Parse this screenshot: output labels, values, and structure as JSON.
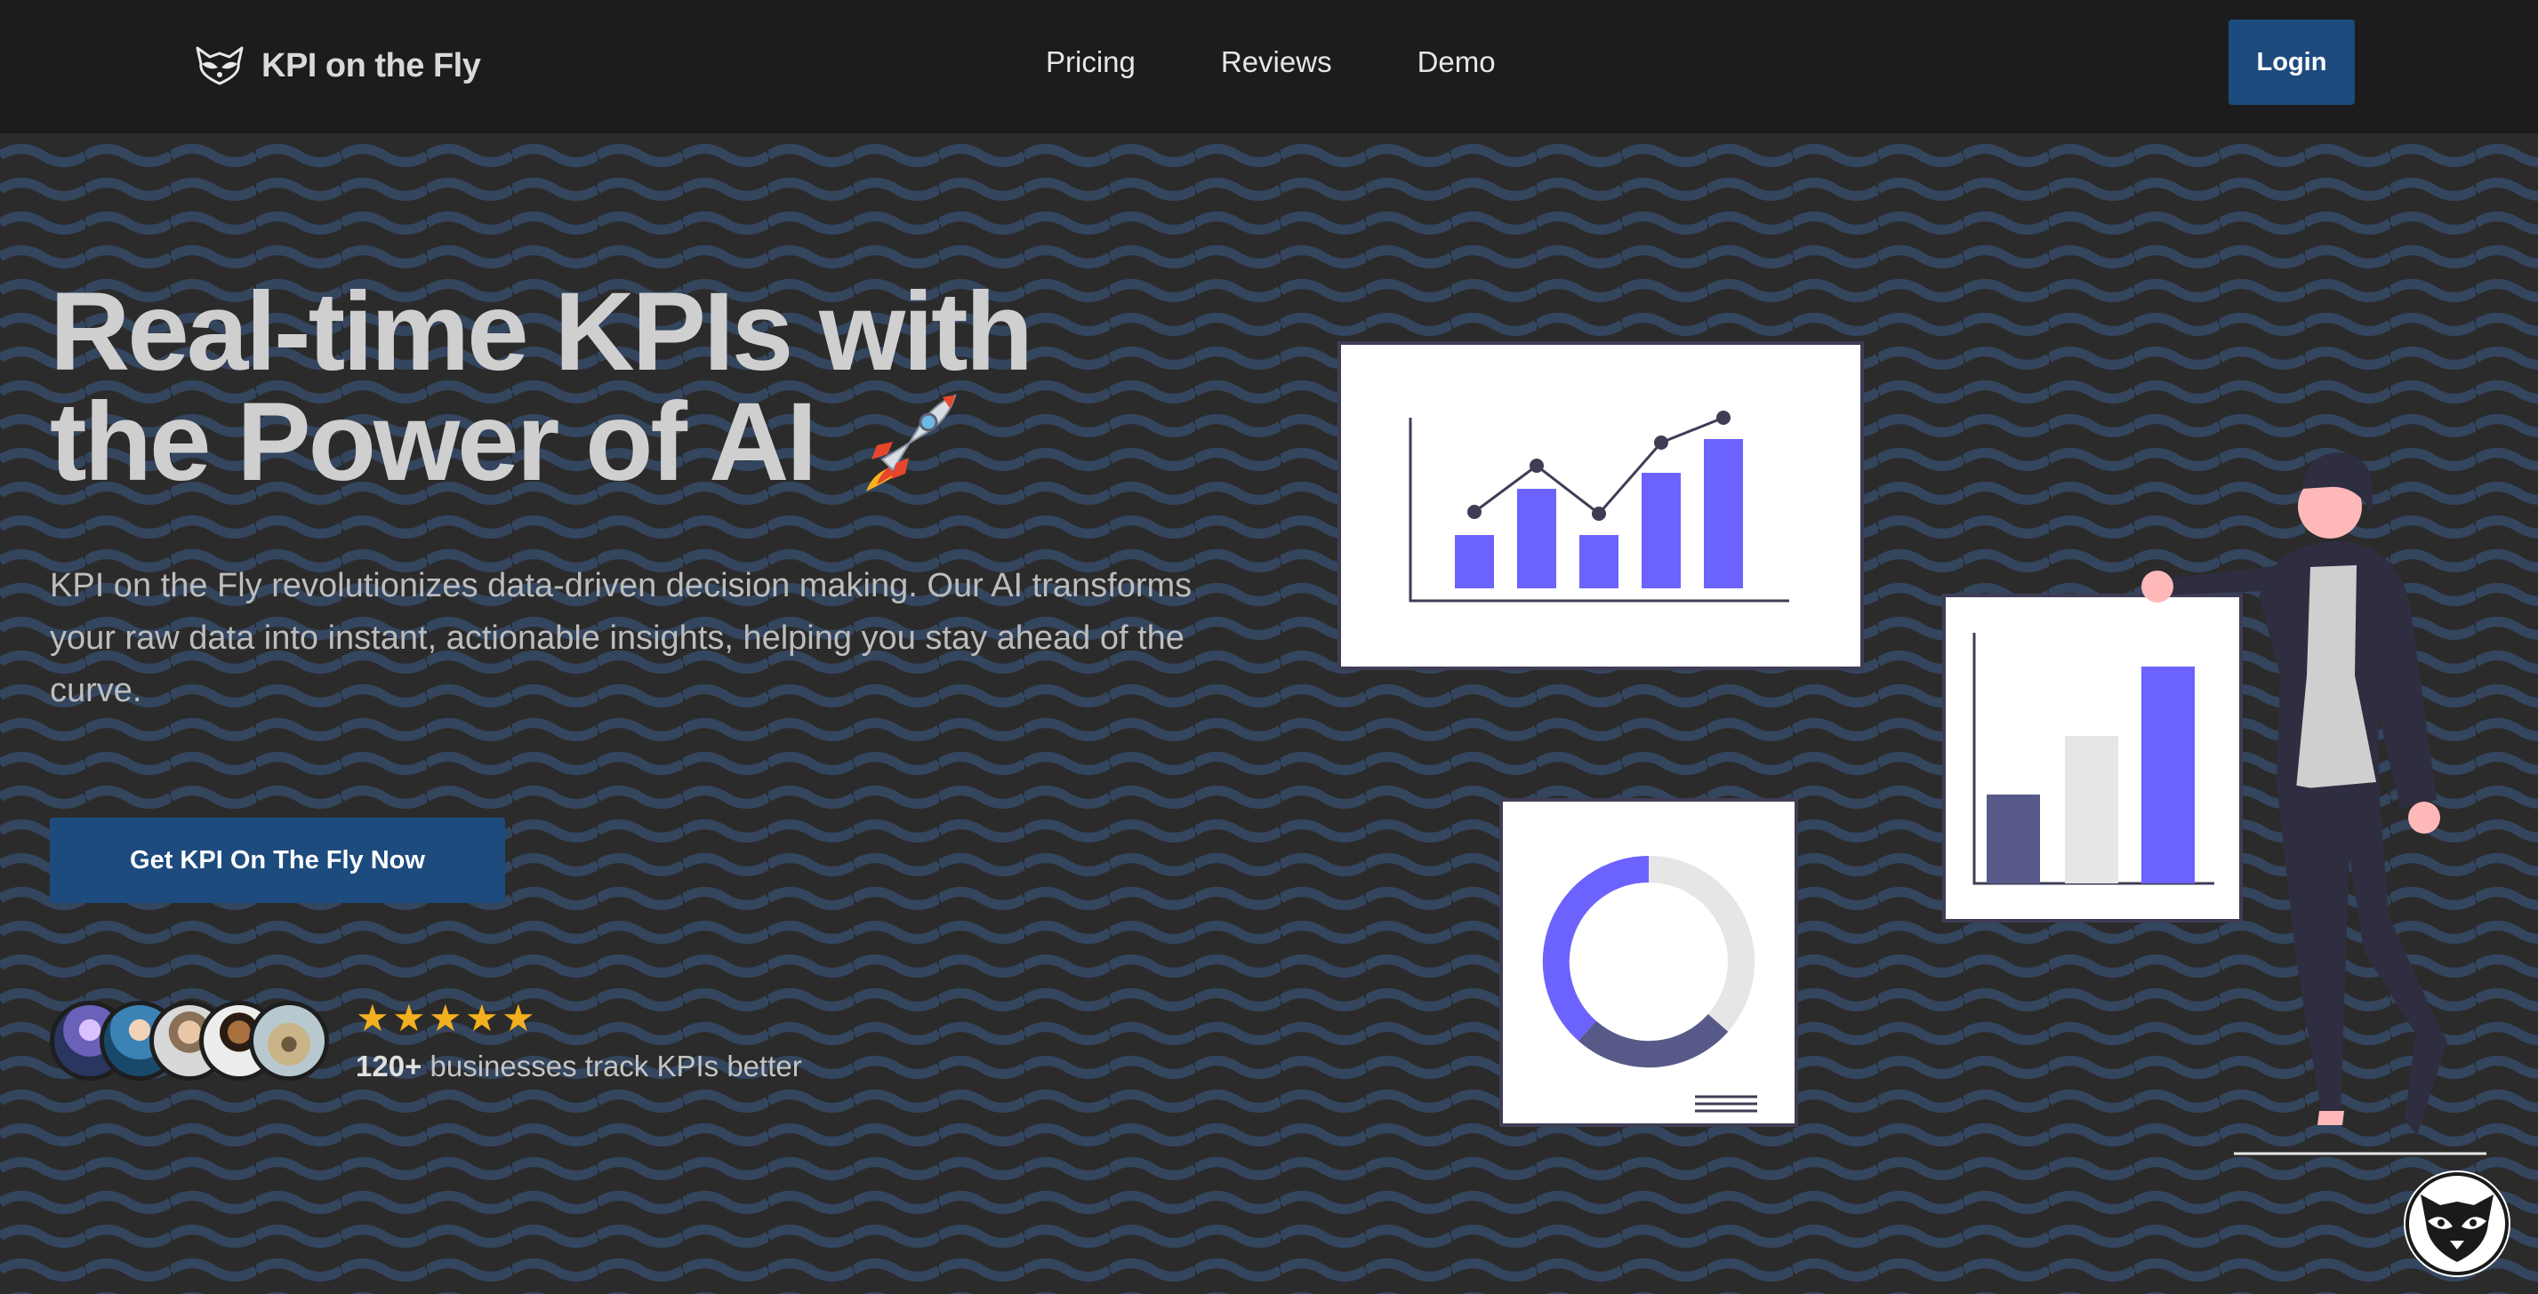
{
  "nav": {
    "brand": "KPI on the Fly",
    "links": [
      "Pricing",
      "Reviews",
      "Demo"
    ],
    "login": "Login"
  },
  "hero": {
    "headline_line1": "Real-time KPIs with",
    "headline_line2": "the Power of AI",
    "headline_emoji": "rocket-icon",
    "description": "KPI on the Fly revolutionizes data-driven decision making. Our AI transforms your raw data into instant, actionable insights, helping you stay ahead of the curve.",
    "cta": "Get KPI On The Fly Now"
  },
  "social_proof": {
    "rating_stars": 5,
    "count": "120+",
    "text": "businesses track KPIs better"
  },
  "colors": {
    "nav_bg": "#1c1c1c",
    "hero_bg": "#2b2b2b",
    "wave": "#34455e",
    "button": "#1d4b7e",
    "accent_purple": "#6c63ff",
    "star": "#f2b01e"
  },
  "icons": [
    "raccoon-logo-icon",
    "rocket-icon",
    "star-icon",
    "raccoon-badge-icon"
  ]
}
